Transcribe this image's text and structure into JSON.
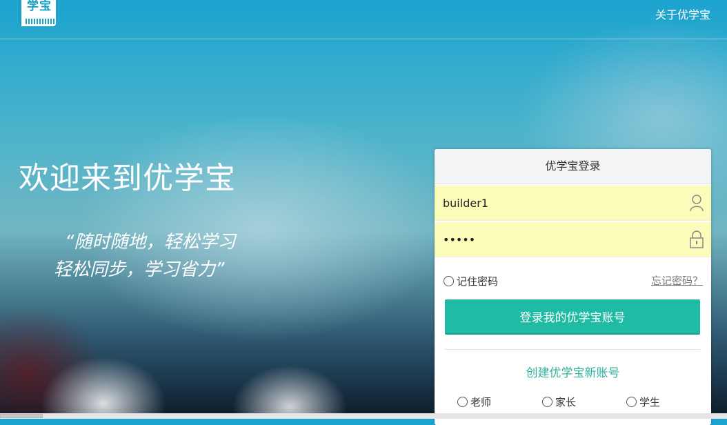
{
  "header": {
    "logo_text": "学宝",
    "about_link": "关于优学宝"
  },
  "hero": {
    "welcome": "欢迎来到优学宝",
    "slogan_line1": "“随时随地，轻松学习",
    "slogan_line2": "轻松同步，学习省力”"
  },
  "login": {
    "title": "优学宝登录",
    "username_value": "builder1",
    "password_value": "•••••",
    "remember_label": "记住密码",
    "forgot_link": "忘记密码？",
    "submit_label": "登录我的优学宝账号",
    "create_link": "创建优学宝新账号",
    "roles": [
      "老师",
      "家长",
      "学生"
    ]
  },
  "colors": {
    "accent": "#1fbba5",
    "autofill": "#fbfcb9",
    "brand_blue": "#18a0c6"
  },
  "icons": {
    "user": "user-icon",
    "lock": "lock-icon"
  }
}
